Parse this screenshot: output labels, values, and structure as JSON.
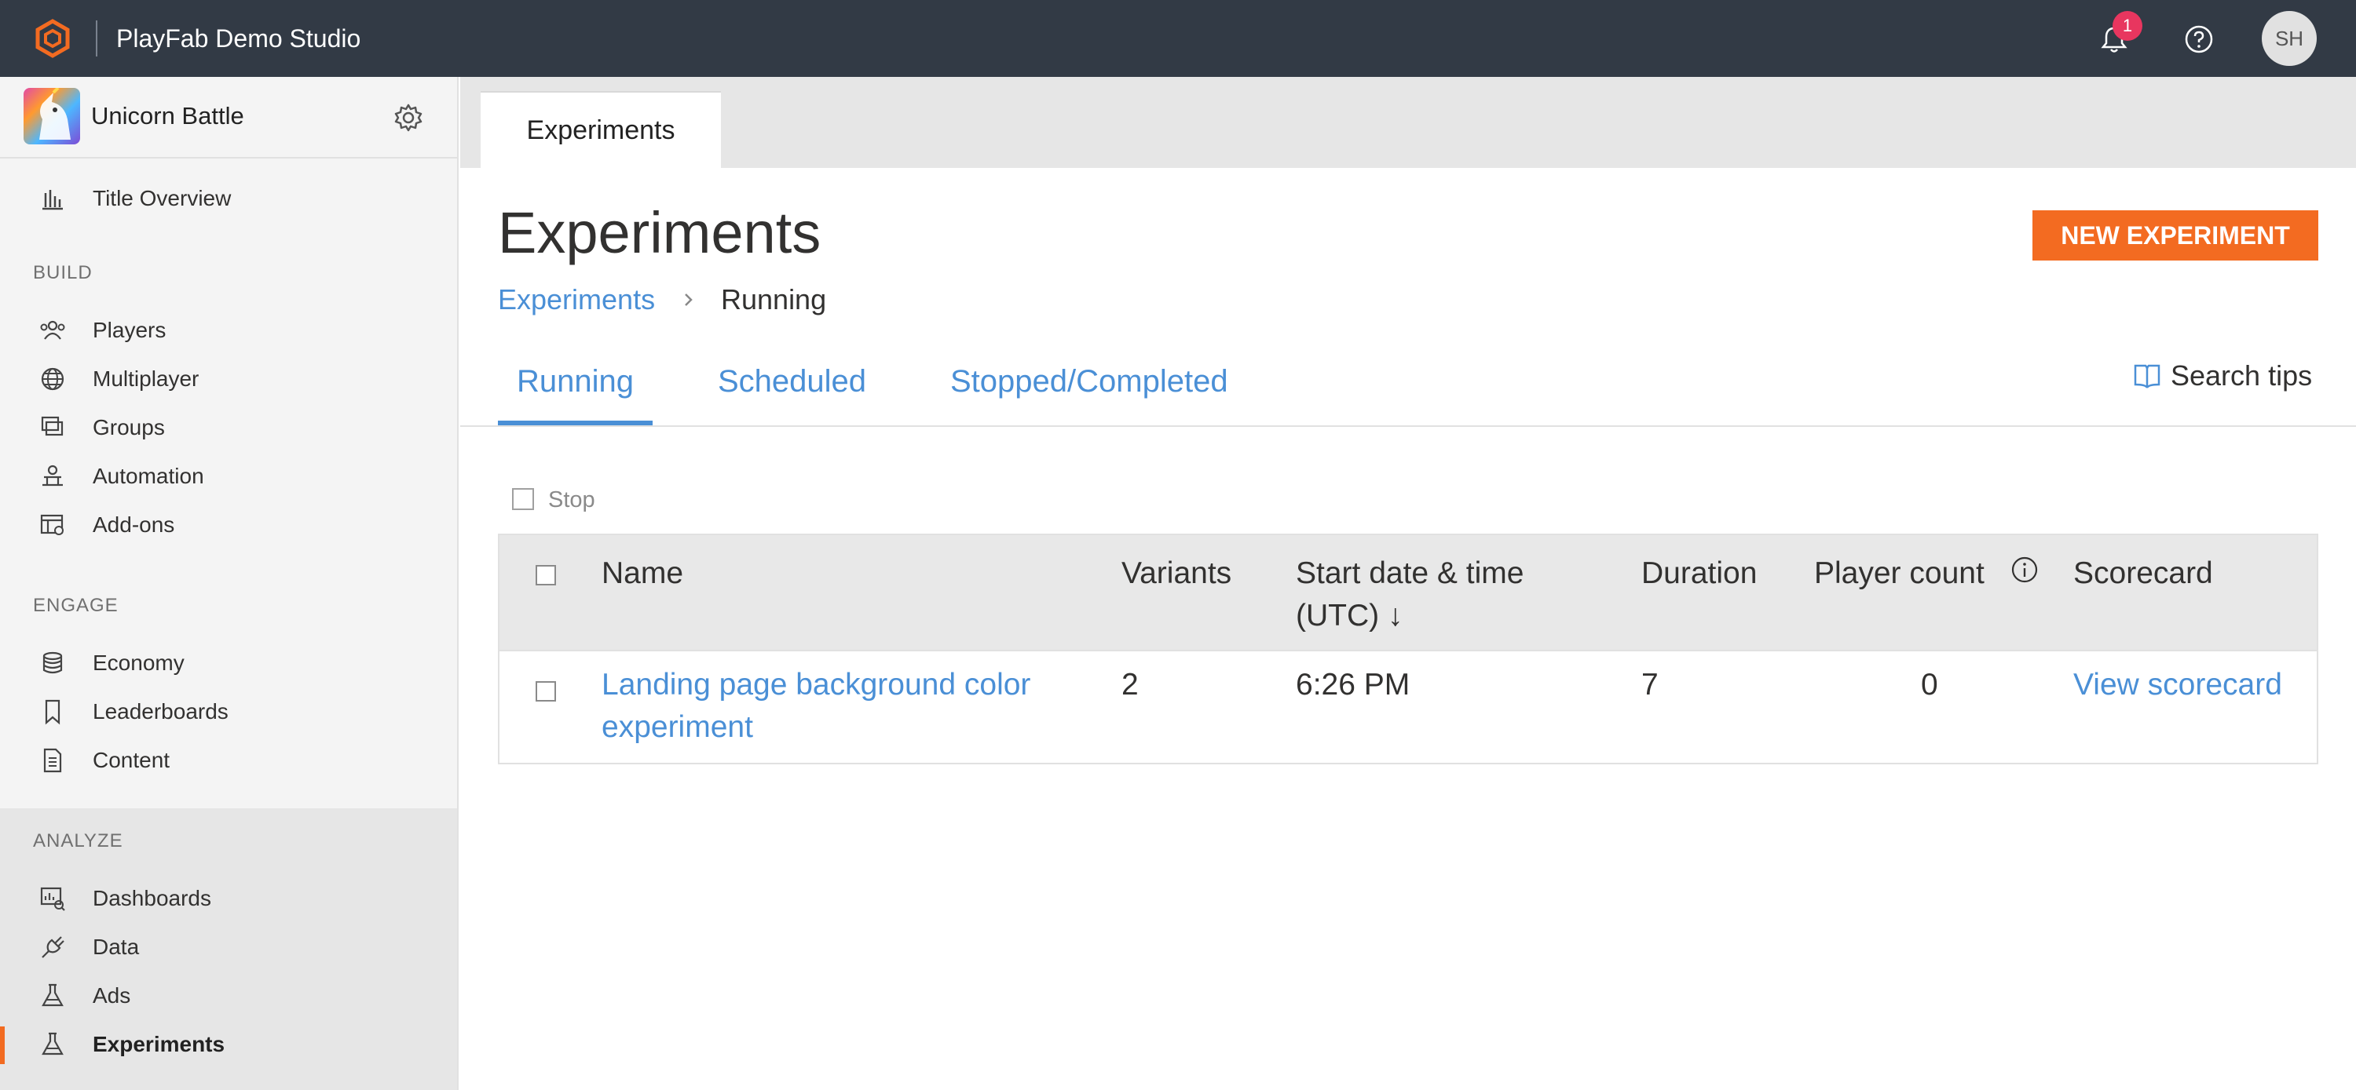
{
  "topbar": {
    "studio_name": "PlayFab Demo Studio",
    "notification_count": "1",
    "avatar_initials": "SH"
  },
  "sidebar": {
    "game_title": "Unicorn Battle",
    "title_overview": "Title Overview",
    "sections": {
      "build": "BUILD",
      "engage": "ENGAGE",
      "analyze": "ANALYZE"
    },
    "build_items": [
      "Players",
      "Multiplayer",
      "Groups",
      "Automation",
      "Add-ons"
    ],
    "engage_items": [
      "Economy",
      "Leaderboards",
      "Content"
    ],
    "analyze_items": [
      "Dashboards",
      "Data",
      "Ads",
      "Experiments"
    ],
    "active_item": "Experiments"
  },
  "main": {
    "tab_label": "Experiments",
    "page_title": "Experiments",
    "new_button_label": "NEW EXPERIMENT",
    "breadcrumb": {
      "parent": "Experiments",
      "current": "Running"
    },
    "subtabs": [
      "Running",
      "Scheduled",
      "Stopped/Completed"
    ],
    "active_subtab": "Running",
    "search_tips": "Search tips",
    "stop_label": "Stop",
    "table": {
      "columns": {
        "name": "Name",
        "variants": "Variants",
        "start_line1": "Start date & time",
        "start_line2": "(UTC) ↓",
        "duration": "Duration",
        "player_count": "Player count",
        "scorecard": "Scorecard"
      },
      "rows": [
        {
          "name_line1": "Landing page background color",
          "name_line2": "experiment",
          "variants": "2",
          "start": "6:26 PM",
          "duration": "7",
          "player_count": "0",
          "scorecard": "View scorecard"
        }
      ]
    }
  },
  "colors": {
    "topbar_bg": "#323a45",
    "accent_orange": "#f36b21",
    "link_blue": "#4a8fd6",
    "badge_pink": "#e8365f"
  }
}
